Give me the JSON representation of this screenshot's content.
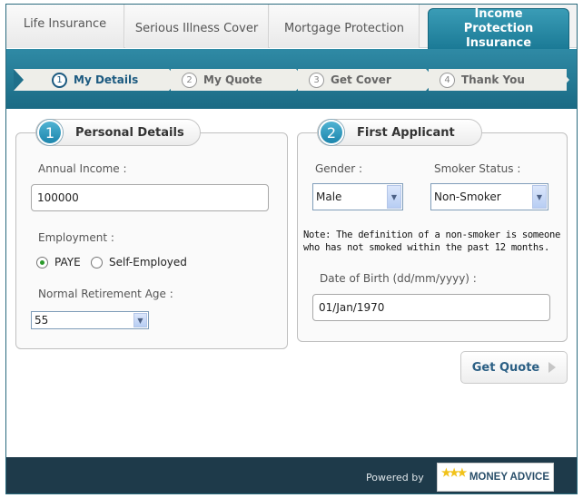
{
  "tabs": [
    {
      "label": "Life Insurance"
    },
    {
      "label": "Serious Illness Cover"
    },
    {
      "label": "Mortgage Protection"
    },
    {
      "label": "Income Protection Insurance"
    }
  ],
  "steps": [
    {
      "num": "1",
      "label": "My Details"
    },
    {
      "num": "2",
      "label": "My Quote"
    },
    {
      "num": "3",
      "label": "Get Cover"
    },
    {
      "num": "4",
      "label": "Thank You"
    }
  ],
  "personal": {
    "num": "1",
    "title": "Personal Details",
    "income_label": "Annual Income :",
    "income_value": "100000",
    "employment_label": "Employment :",
    "paye_label": "PAYE",
    "self_employed_label": "Self-Employed",
    "retirement_label": "Normal Retirement Age :",
    "retirement_value": "55"
  },
  "applicant": {
    "num": "2",
    "title": "First Applicant",
    "gender_label": "Gender :",
    "gender_value": "Male",
    "smoker_label": "Smoker Status :",
    "smoker_value": "Non-Smoker",
    "note": "Note: The definition of a non-smoker is someone who has not smoked within the past 12 months.",
    "dob_label": "Date of Birth (dd/mm/yyyy) :",
    "dob_value": "01/Jan/1970"
  },
  "actions": {
    "get_quote": "Get Quote"
  },
  "footer": {
    "powered_by": "Powered by",
    "logo_text": "MONEY ADVICE"
  },
  "colors": {
    "accent": "#1b6b85",
    "footer": "#1e3a4a",
    "button_text": "#2b5f84"
  }
}
